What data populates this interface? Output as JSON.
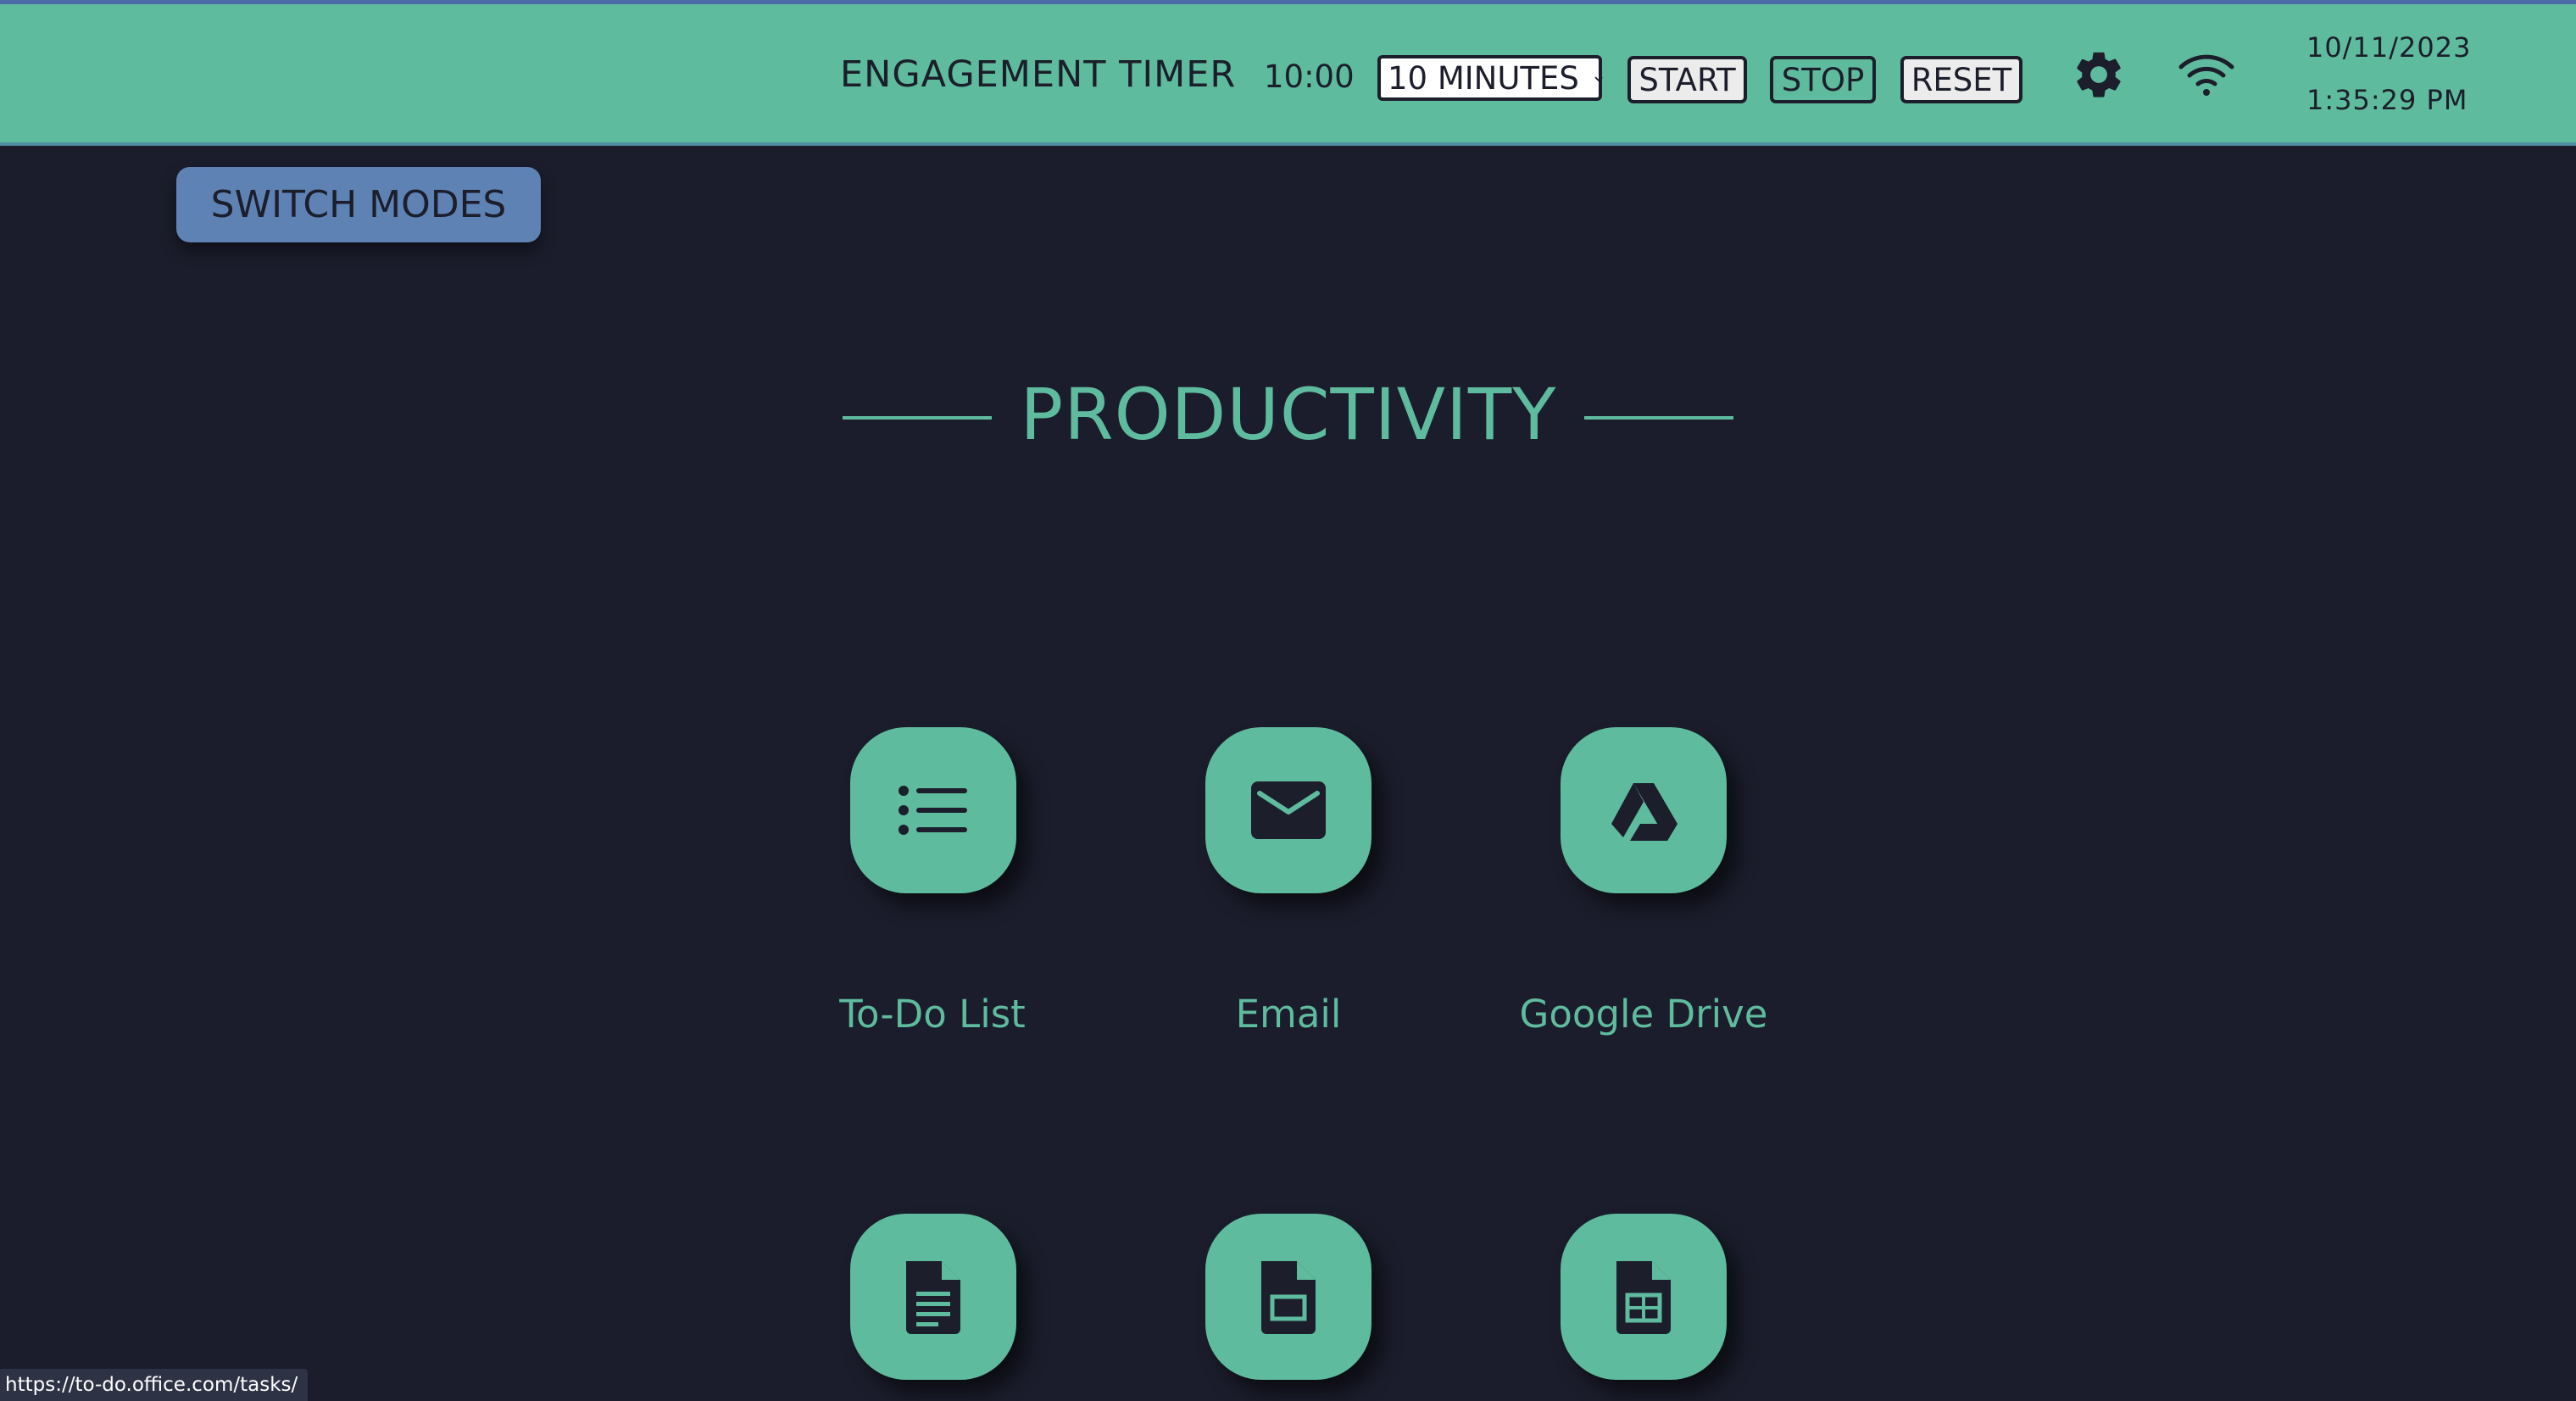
{
  "topbar": {
    "title": "ENGAGEMENT TIMER",
    "time_remaining": "10:00",
    "duration_selected": "10 MINUTES",
    "start_label": "START",
    "stop_label": "STOP",
    "reset_label": "RESET",
    "settings_icon": "gear-icon",
    "wifi_icon": "wifi-icon",
    "date": "10/11/2023",
    "clock": "1:35:29 PM"
  },
  "switch_modes_label": "SWITCH MODES",
  "section": {
    "title": "PRODUCTIVITY",
    "apps": [
      {
        "label": "To-Do List",
        "icon": "list-icon"
      },
      {
        "label": "Email",
        "icon": "envelope-icon"
      },
      {
        "label": "Google Drive",
        "icon": "drive-icon"
      },
      {
        "label": "",
        "icon": "document-icon"
      },
      {
        "label": "",
        "icon": "slides-icon"
      },
      {
        "label": "",
        "icon": "sheets-icon"
      }
    ]
  },
  "status_bar_url": "https://to-do.office.com/tasks/",
  "colors": {
    "accent": "#5fbb9d",
    "background": "#1b1d2c",
    "switch_button": "#5f82b5",
    "dark_text": "#1c1e2b"
  }
}
